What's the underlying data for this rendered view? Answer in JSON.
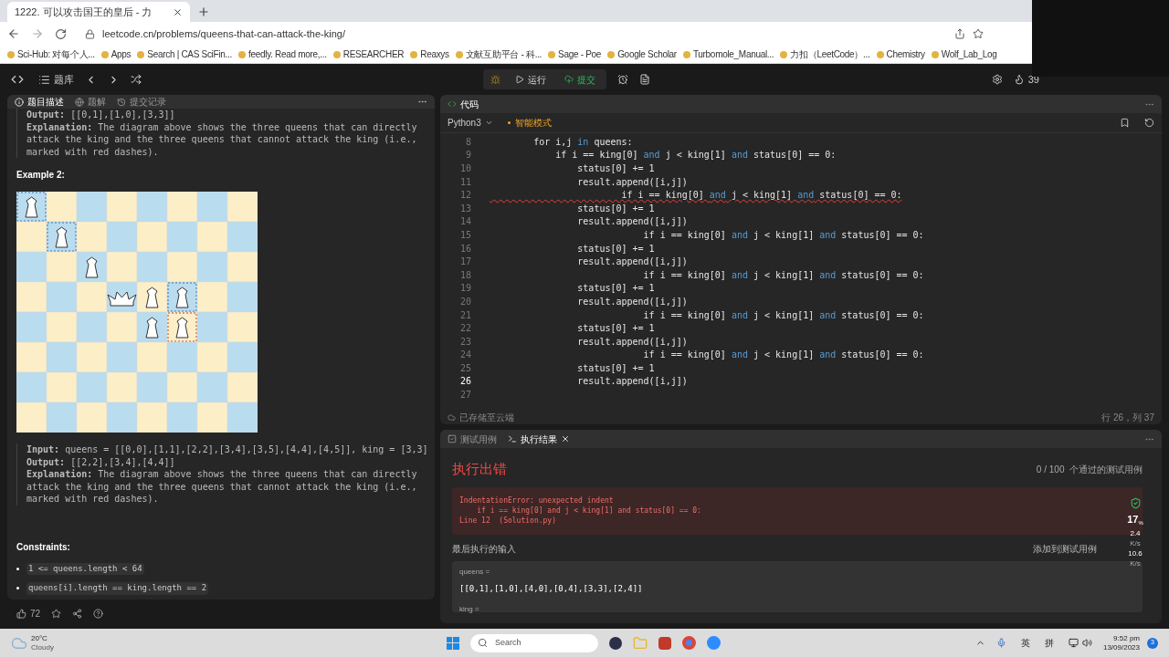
{
  "browser": {
    "tab_title": "1222. 可以攻击国王的皇后 - 力",
    "url": "leetcode.cn/problems/queens-that-can-attack-the-king/",
    "bookmarks": [
      {
        "label": "Sci-Hub: 对每个人..."
      },
      {
        "label": "Apps"
      },
      {
        "label": "Search | CAS SciFin..."
      },
      {
        "label": "feedly. Read more,..."
      },
      {
        "label": "RESEARCHER"
      },
      {
        "label": "Reaxys"
      },
      {
        "label": "文献互助平台 - 科..."
      },
      {
        "label": "Sage - Poe"
      },
      {
        "label": "Google Scholar"
      },
      {
        "label": "Turbomole_Manual..."
      },
      {
        "label": "力扣（LeetCode）..."
      },
      {
        "label": "Chemistry"
      },
      {
        "label": "Wolf_Lab_Log"
      }
    ]
  },
  "nav": {
    "title": "题库",
    "run": "运行",
    "submit": "提交",
    "streak": "39"
  },
  "description": {
    "tabs": [
      {
        "label": "题目描述",
        "selected": true
      },
      {
        "label": "题解",
        "selected": false
      },
      {
        "label": "提交记录",
        "selected": false
      }
    ],
    "example1_lines": [
      "**Output:** [[0,1],[1,0],[3,3]]",
      "**Explanation:** The diagram above shows the three queens that can directly",
      "attack the king and the three queens that cannot attack the king (i.e.,",
      "marked with red dashes)."
    ],
    "example2_heading": "Example 2:",
    "example2_lines": [
      "**Input:** queens = [[0,0],[1,1],[2,2],[3,4],[3,5],[4,4],[4,5]], king = [3,3]",
      "**Output:** [[2,2],[3,4],[4,4]]",
      "**Explanation:** The diagram above shows the three queens that can directly",
      "attack the king and the three queens that cannot attack the king (i.e.,",
      "marked with red dashes)."
    ],
    "constraints_heading": "Constraints:",
    "constraints": [
      "1 <= queens.length < 64",
      "queens[i].length == king.length == 2"
    ],
    "likes": "72"
  },
  "editor": {
    "title": "代码",
    "language": "Python3",
    "mode": "智能模式",
    "lines": [
      {
        "number": "8",
        "current": false,
        "error": false,
        "tokens": [
          {
            "kind": "plain",
            "text": "        for i,j "
          },
          {
            "kind": "keyword",
            "text": "in"
          },
          {
            "kind": "plain",
            "text": " queens:"
          }
        ]
      },
      {
        "number": "9",
        "current": false,
        "error": false,
        "tokens": [
          {
            "kind": "plain",
            "text": "            if i == king[0] "
          },
          {
            "kind": "keyword",
            "text": "and"
          },
          {
            "kind": "plain",
            "text": " j < king[1] "
          },
          {
            "kind": "keyword",
            "text": "and"
          },
          {
            "kind": "plain",
            "text": " status[0] == 0:"
          }
        ]
      },
      {
        "number": "10",
        "current": false,
        "error": false,
        "tokens": [
          {
            "kind": "plain",
            "text": "                status[0] += 1"
          }
        ]
      },
      {
        "number": "11",
        "current": false,
        "error": false,
        "tokens": [
          {
            "kind": "plain",
            "text": "                result.append([i,j])"
          }
        ]
      },
      {
        "number": "12",
        "current": false,
        "error": true,
        "tokens": [
          {
            "kind": "plain",
            "text": "                        if i == king[0] "
          },
          {
            "kind": "keyword",
            "text": "and"
          },
          {
            "kind": "plain",
            "text": " j < king[1] "
          },
          {
            "kind": "keyword",
            "text": "and"
          },
          {
            "kind": "plain",
            "text": " status[0] == 0:"
          }
        ]
      },
      {
        "number": "13",
        "current": false,
        "error": false,
        "tokens": [
          {
            "kind": "plain",
            "text": "                status[0] += 1"
          }
        ]
      },
      {
        "number": "14",
        "current": false,
        "error": false,
        "tokens": [
          {
            "kind": "plain",
            "text": "                result.append([i,j])"
          }
        ]
      },
      {
        "number": "15",
        "current": false,
        "error": false,
        "tokens": [
          {
            "kind": "plain",
            "text": "                            if i == king[0] "
          },
          {
            "kind": "keyword",
            "text": "and"
          },
          {
            "kind": "plain",
            "text": " j < king[1] "
          },
          {
            "kind": "keyword",
            "text": "and"
          },
          {
            "kind": "plain",
            "text": " status[0] == 0:"
          }
        ]
      },
      {
        "number": "16",
        "current": false,
        "error": false,
        "tokens": [
          {
            "kind": "plain",
            "text": "                status[0] += 1"
          }
        ]
      },
      {
        "number": "17",
        "current": false,
        "error": false,
        "tokens": [
          {
            "kind": "plain",
            "text": "                result.append([i,j])"
          }
        ]
      },
      {
        "number": "18",
        "current": false,
        "error": false,
        "tokens": [
          {
            "kind": "plain",
            "text": "                            if i == king[0] "
          },
          {
            "kind": "keyword",
            "text": "and"
          },
          {
            "kind": "plain",
            "text": " j < king[1] "
          },
          {
            "kind": "keyword",
            "text": "and"
          },
          {
            "kind": "plain",
            "text": " status[0] == 0:"
          }
        ]
      },
      {
        "number": "19",
        "current": false,
        "error": false,
        "tokens": [
          {
            "kind": "plain",
            "text": "                status[0] += 1"
          }
        ]
      },
      {
        "number": "20",
        "current": false,
        "error": false,
        "tokens": [
          {
            "kind": "plain",
            "text": "                result.append([i,j])"
          }
        ]
      },
      {
        "number": "21",
        "current": false,
        "error": false,
        "tokens": [
          {
            "kind": "plain",
            "text": "                            if i == king[0] "
          },
          {
            "kind": "keyword",
            "text": "and"
          },
          {
            "kind": "plain",
            "text": " j < king[1] "
          },
          {
            "kind": "keyword",
            "text": "and"
          },
          {
            "kind": "plain",
            "text": " status[0] == 0:"
          }
        ]
      },
      {
        "number": "22",
        "current": false,
        "error": false,
        "tokens": [
          {
            "kind": "plain",
            "text": "                status[0] += 1"
          }
        ]
      },
      {
        "number": "23",
        "current": false,
        "error": false,
        "tokens": [
          {
            "kind": "plain",
            "text": "                result.append([i,j])"
          }
        ]
      },
      {
        "number": "24",
        "current": false,
        "error": false,
        "tokens": [
          {
            "kind": "plain",
            "text": "                            if i == king[0] "
          },
          {
            "kind": "keyword",
            "text": "and"
          },
          {
            "kind": "plain",
            "text": " j < king[1] "
          },
          {
            "kind": "keyword",
            "text": "and"
          },
          {
            "kind": "plain",
            "text": " status[0] == 0:"
          }
        ]
      },
      {
        "number": "25",
        "current": false,
        "error": false,
        "tokens": [
          {
            "kind": "plain",
            "text": "                status[0] += 1"
          }
        ]
      },
      {
        "number": "26",
        "current": true,
        "error": false,
        "tokens": [
          {
            "kind": "plain",
            "text": "                result.append([i,j])"
          }
        ]
      },
      {
        "number": "27",
        "current": false
      }
    ],
    "save_status": "已存储至云端",
    "cursor": "行 26，列 37"
  },
  "result": {
    "tabs": [
      {
        "label": "测试用例",
        "selected": false
      },
      {
        "label": "执行结果",
        "selected": true
      }
    ],
    "heading": "执行出错",
    "passed": "0 / 100  个通过的测试用例",
    "error_lines": [
      "IndentationError: unexpected indent",
      "    if i == king[0] and j < king[1] and status[0] == 0:",
      "Line 12  (Solution.py)"
    ],
    "last_input_label": "最后执行的输入",
    "add_case": "添加到测试用例",
    "inputs": [
      {
        "name": "queens =",
        "value": "[[0,1],[1,0],[4,0],[0,4],[3,3],[2,4]]"
      },
      {
        "name": "king ="
      }
    ]
  },
  "monitor": {
    "cpu": "17",
    "cpu_unit": "%",
    "up": "2.4",
    "up_unit": "K/s",
    "down": "10.6",
    "down_unit": "K/s"
  },
  "taskbar": {
    "temperature": "20°C",
    "weather": "Cloudy",
    "search_placeholder": "Search",
    "ime": [
      "英",
      "拼"
    ],
    "time": "9:52 pm",
    "date": "13/09/2023",
    "notifications": "3"
  }
}
